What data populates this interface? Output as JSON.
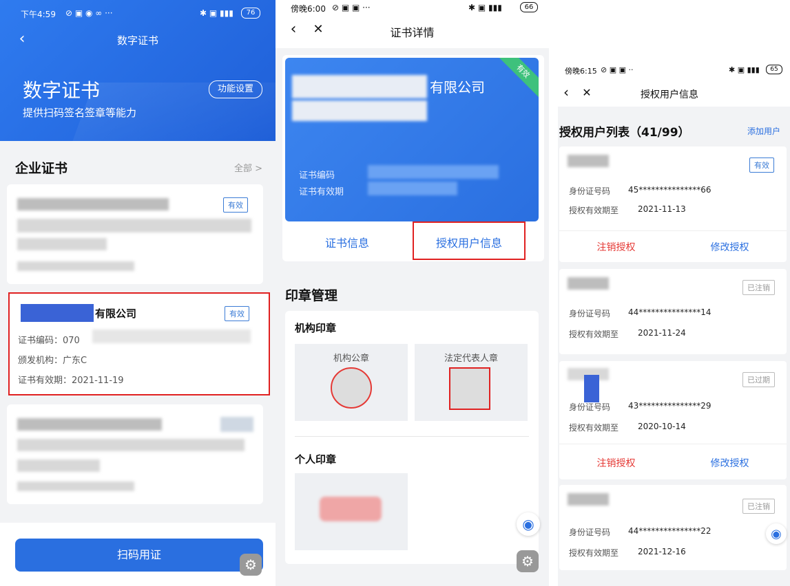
{
  "screen1": {
    "status_time": "下午4:59",
    "battery": "76",
    "header_title": "数字证书",
    "hero_title": "数字证书",
    "hero_subtitle": "提供扫码签名签章等能力",
    "settings_button": "功能设置",
    "section_title": "企业证书",
    "section_all": "全部 >",
    "card1_badge": "有效",
    "card2_company": "有限公司",
    "card2_badge": "有效",
    "card2_code": "证书编码：070",
    "card2_issuer": "颁发机构：广东C",
    "card2_validity": "证书有效期：2021-11-19",
    "scan_button": "扫码用证"
  },
  "screen2": {
    "status_time": "傍晚6:00",
    "battery": "66",
    "header_title": "证书详情",
    "card_company": "有限公司",
    "card_ribbon": "有效",
    "card_code_label": "证书编码",
    "card_validity_label": "证书有效期",
    "tab_cert_info": "证书信息",
    "tab_auth_users": "授权用户信息",
    "seal_section_title": "印章管理",
    "org_seal_title": "机构印章",
    "org_seal_1": "机构公章",
    "org_seal_2": "法定代表人章",
    "personal_seal_title": "个人印章"
  },
  "screen3": {
    "status_time": "傍晚6:15",
    "battery": "65",
    "header_title": "授权用户信息",
    "list_title": "授权用户列表（41/99）",
    "add_user": "添加用户",
    "id_label": "身份证号码",
    "valid_label": "授权有效期至",
    "revoke": "注销授权",
    "modify": "修改授权",
    "users": [
      {
        "badge": "有效",
        "id": "45***************66",
        "valid": "2021-11-13"
      },
      {
        "badge": "已注销",
        "id": "44***************14",
        "valid": "2021-11-24"
      },
      {
        "badge": "已过期",
        "id": "43***************29",
        "valid": "2020-10-14"
      },
      {
        "badge": "已注销",
        "id": "44***************22",
        "valid": "2021-12-16"
      }
    ]
  },
  "colors": {
    "primary": "#2a6fe0",
    "red": "#e53935",
    "highlight_border": "#e02020"
  }
}
